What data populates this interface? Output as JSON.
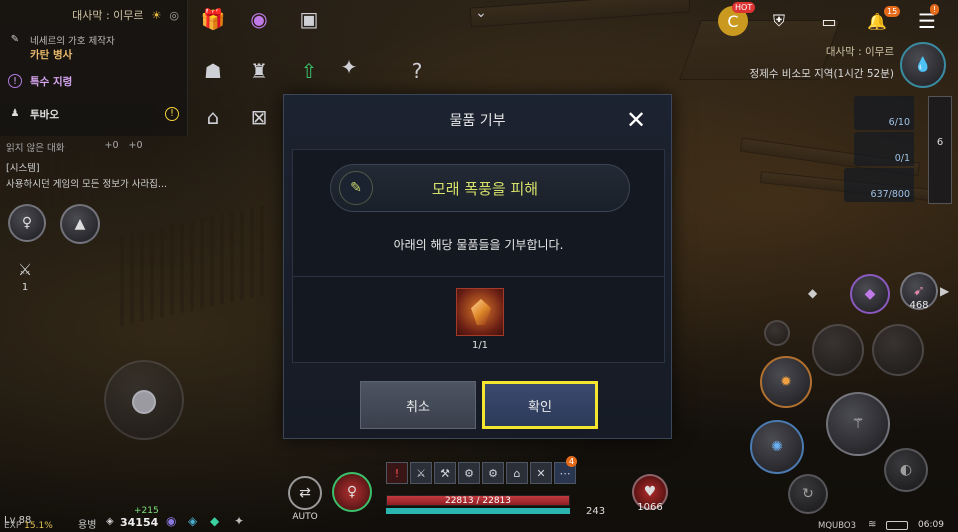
{
  "quest_panel": {
    "region_title": "대사막 : 이무르",
    "items": [
      {
        "subtitle": "네세르의 가호 제작자",
        "title": "카탄 병사"
      },
      {
        "title": "특수 지령"
      },
      {
        "title": "투바오"
      }
    ]
  },
  "chat": {
    "unread_label": "읽지 않은 대화",
    "count_a": "+0",
    "count_b": "+0",
    "system_tag": "[시스템]",
    "system_msg": "사용하시던 게임의 모든 정보가 사라집..."
  },
  "left_skill": {
    "count": "1"
  },
  "top_right": {
    "hot_badge": "HOT",
    "notice_count": "15",
    "region": "대사막 : 이무르",
    "zone_status": "정제수 비소모 지역(1시간 52분)"
  },
  "side_panel": {
    "slot1": "6/10",
    "slot2": "0/1",
    "slot3": "637/800",
    "quest_count": "6"
  },
  "modal": {
    "title": "물품 기부",
    "close_symbol": "✕",
    "quest_name": "모래 폭풍을 피해",
    "description": "아래의 해당 물품들을 기부합니다.",
    "item_count": "1/1",
    "cancel_label": "취소",
    "confirm_label": "확인"
  },
  "bottom": {
    "level": "Lv 88",
    "exp_label": "EXP",
    "exp_value": "15.1%",
    "mercenary_label": "용병",
    "gain": "+215",
    "silver": "34154",
    "auto_label": "AUTO",
    "hp_text": "22813 / 22813",
    "hp_fraction": 1.0,
    "potion_count": "243",
    "right_count": "1066",
    "skill_badge": "4",
    "right_skill_count": "468",
    "device_name": "MQUBO3",
    "clock": "06:09"
  },
  "colors": {
    "confirm_highlight": "#f4e52e",
    "quest_text": "#d6e06a",
    "hp": "#c23a3f",
    "mp": "#2bb5b0"
  }
}
